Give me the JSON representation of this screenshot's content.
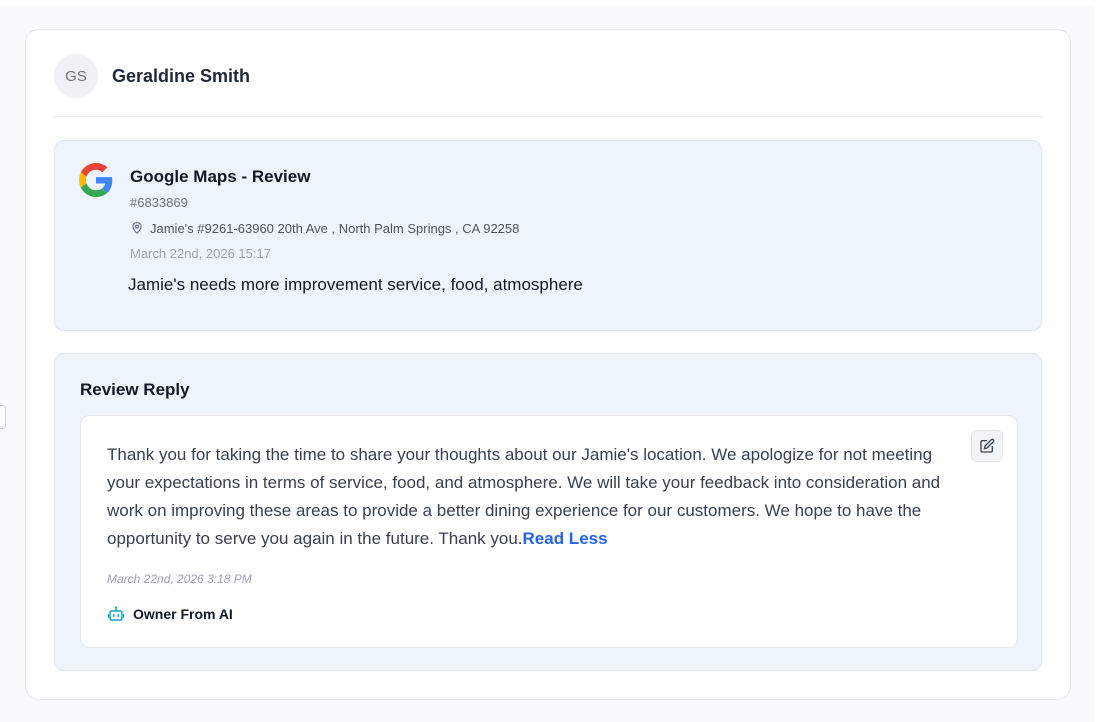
{
  "user": {
    "initials": "GS",
    "name": "Geraldine Smith"
  },
  "review": {
    "source_title": "Google Maps - Review",
    "id": "#6833869",
    "location": "Jamie's #9261-63960 20th Ave , North Palm Springs , CA 92258",
    "date": "March 22nd, 2026 15:17",
    "text": "Jamie's needs more improvement service, food, atmosphere"
  },
  "reply": {
    "title": "Review Reply",
    "text": "Thank you for taking the time to share your thoughts about our Jamie's location. We apologize for not meeting your expectations in terms of service, food, and atmosphere. We will take your feedback into consideration and work on improving these areas to provide a better dining experience for our customers. We hope to have the opportunity to serve you again in the future. Thank you.",
    "read_less_label": "Read Less",
    "date": "March 22nd, 2026 3:18 PM",
    "author_label": "Owner From AI"
  },
  "icons": {
    "source": "google-icon",
    "location": "map-pin-icon",
    "edit": "edit-icon",
    "author": "robot-icon"
  },
  "colors": {
    "accent_link": "#2563eb",
    "robot_icon": "#0ea5c6",
    "panel_background": "#eef4fc"
  }
}
